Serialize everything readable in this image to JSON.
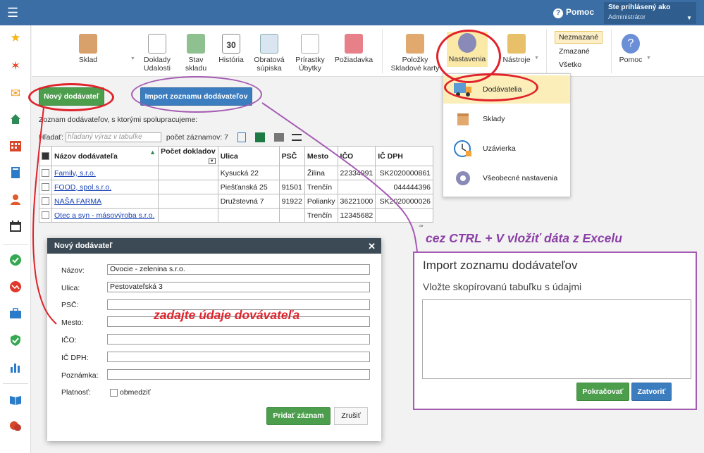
{
  "topbar": {
    "help": "Pomoc",
    "user_title": "Ste prihlásený ako",
    "user_name": "Administrátor"
  },
  "sidebar_icons": [
    "star-icon",
    "magic-wand-icon",
    "mail-icon",
    "home-icon",
    "calendar-grid-icon",
    "book-icon",
    "user-icon",
    "calendar-icon",
    "check-circle-icon",
    "chart-down-icon",
    "briefcase-icon",
    "shield-check-icon",
    "bar-chart-icon",
    "open-book-icon",
    "chat-icon"
  ],
  "ribbon": {
    "sklad": "Sklad",
    "doklady": "Doklady Udalosti",
    "stav": "Stav skladu",
    "historia": "História",
    "historia_day": "30",
    "obratova": "Obratová súpiska",
    "prirastky": "Prírastky Úbytky",
    "poziadavka": "Požiadavka",
    "polozky": "Položky Skladové karty",
    "nastavenia": "Nastavenia",
    "nastroje": "Nástroje",
    "nezmazane": "Nezmazané",
    "zmazane": "Zmazané",
    "vsetko": "Všetko",
    "pomoc": "Pomoc"
  },
  "buttons": {
    "novy": "Nový dodávateľ",
    "import": "Import zoznamu dodávateľov"
  },
  "list": {
    "desc": "Zoznam dodávateľov, s ktorými spolupracujeme:",
    "search_label": "Hľadať:",
    "search_placeholder": "hľadaný výraz v tabuľke",
    "count": "počet záznamov: 7"
  },
  "table": {
    "headers": [
      "Názov dodávateľa",
      "Počet dokladov",
      "Ulica",
      "PSČ",
      "Mesto",
      "IČO",
      "IČ DPH"
    ],
    "rows": [
      [
        "Family, s.r.o.",
        "",
        "Kysucká 22",
        "",
        "Žilina",
        "22334991",
        "SK2020000861"
      ],
      [
        "FOOD, spol.s.r.o.",
        "",
        "Piešťanská 25",
        "91501",
        "Trenčín",
        "",
        "044444396"
      ],
      [
        "NAŠA FARMA",
        "",
        "Družstevná 7",
        "91922",
        "Polianky",
        "36221000",
        "SK2020000026"
      ],
      [
        "Otec a syn - másovýroba s.r.o.",
        "",
        "",
        "",
        "Trenčín",
        "12345682",
        ""
      ]
    ]
  },
  "dialog": {
    "title": "Nový dodávateľ",
    "labels": {
      "nazov": "Názov:",
      "ulica": "Ulica:",
      "psc": "PSČ:",
      "mesto": "Mesto:",
      "ico": "IČO:",
      "icdph": "IČ DPH:",
      "poznamka": "Poznámka:",
      "platnost": "Platnosť:"
    },
    "values": {
      "nazov": "Ovocie - zelenina s.r.o.",
      "ulica": "Pestovateľská 3"
    },
    "obmedzit": "obmedziť",
    "add": "Pridať záznam",
    "cancel": "Zrušiť"
  },
  "annotations": {
    "fill": "zadajte údaje dovávateľa",
    "ctrl": "cez  CTRL + V vložiť dáta z Excelu"
  },
  "import_panel": {
    "title": "Import zoznamu dodávateľov",
    "sub": "Vložte skopírovanú tabuľku s údajmi",
    "continue": "Pokračovať",
    "close": "Zatvoriť"
  },
  "menu": {
    "items": [
      "Dodávatelia",
      "Sklady",
      "Uzávierka",
      "Všeobecné nastavenia"
    ]
  },
  "colors": {
    "topbar": "#3a6ea5",
    "green": "#4c9e4c",
    "blue": "#3c7dbf",
    "red_annotation": "#e0222b",
    "purple_annotation": "#a45bb3",
    "menu_highlight": "#fbeeb8"
  }
}
